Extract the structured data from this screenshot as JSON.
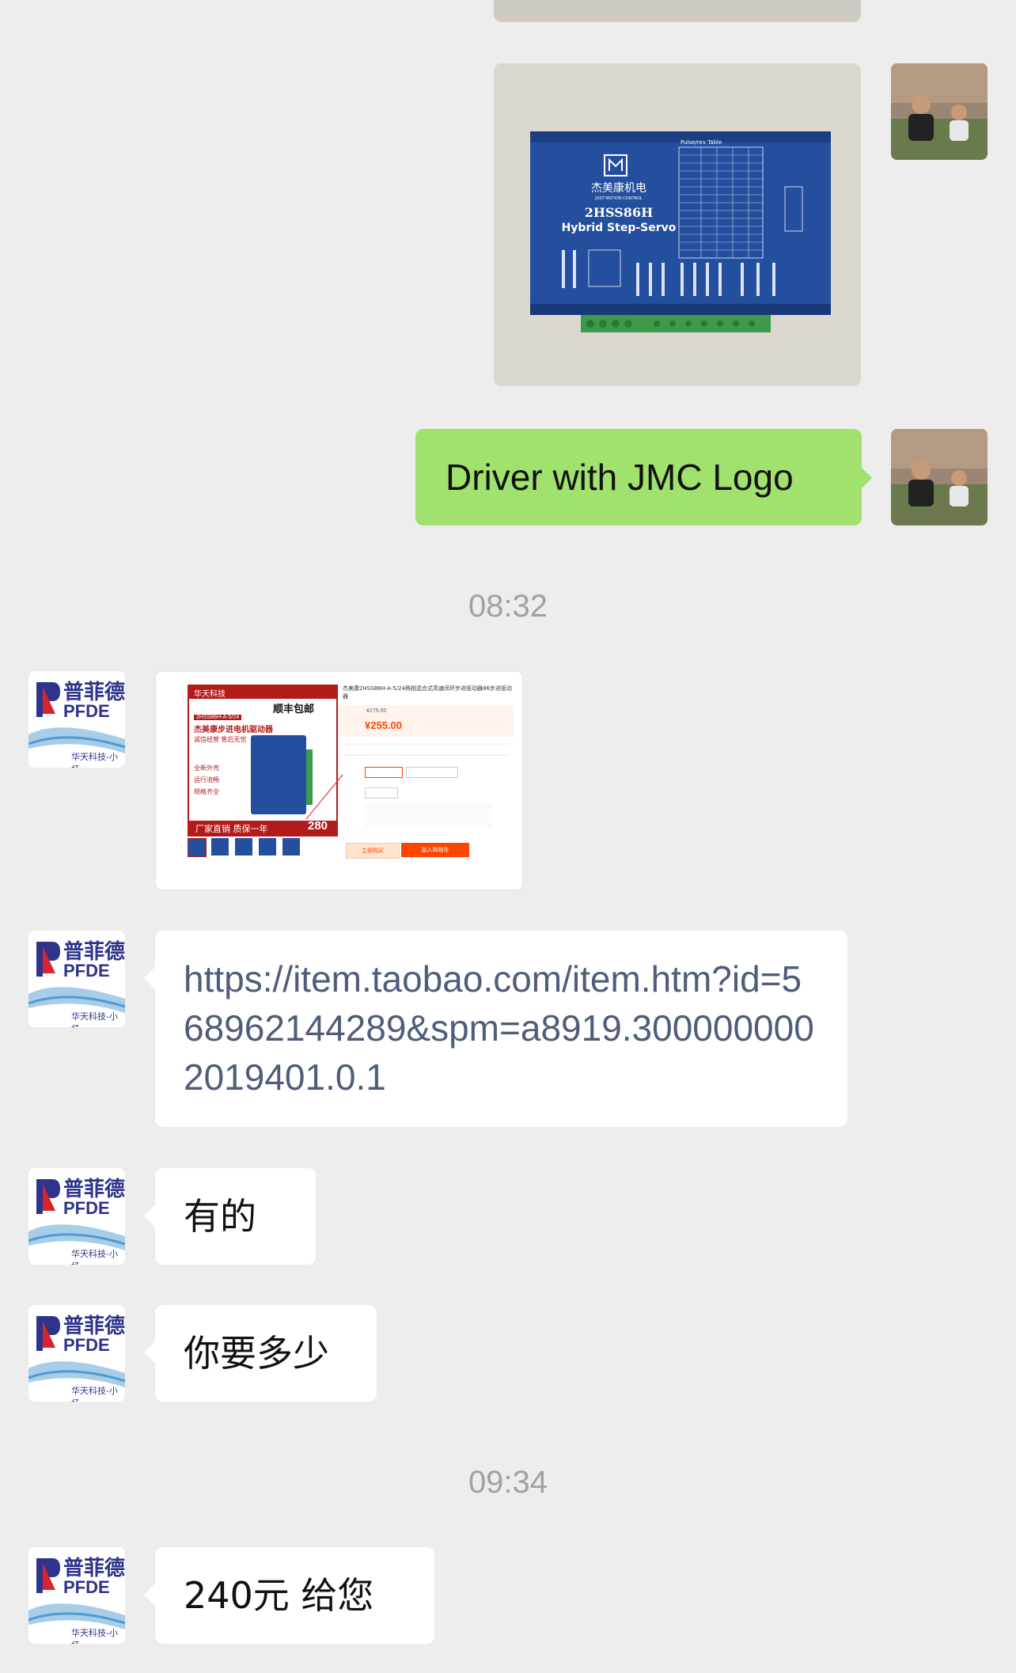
{
  "chat": {
    "msg_jmc": "Driver with JMC Logo",
    "time_1": "08:32",
    "link": "https://item.taobao.com/item.htm?id=568962144289&spm=a8919.3000000002019401.0.1",
    "msg_youde": "有的",
    "msg_how_many": "你要多少",
    "time_2": "09:34",
    "msg_price": "240元 给您"
  },
  "product_photo": {
    "brand_cn": "杰美康机电",
    "brand_en": "JUST MOTION CONTROL",
    "model": "2HSS86H",
    "subtitle": "Hybrid Step-Servo",
    "table_title": "Pulse/rev Table"
  },
  "product_listing": {
    "shop": "华天科技",
    "shipping": "顺丰包邮",
    "model_tag": "2HSS86H-A-5/24",
    "product_name": "杰美康步进电机驱动器",
    "slogan": "诚信经营 售后无忧",
    "bullets": [
      "全新外壳",
      "运行流畅",
      "规格齐全"
    ],
    "footer": "厂家直销 质保一年",
    "price_badge": "280",
    "item_title": "杰美康2HSS86H-A-5/24两相混合式高速闭环步进驱动器86步进驱动器",
    "old_price": "¥275.00",
    "new_price": "¥255.00",
    "buy_now": "立即购买",
    "add_cart": "加入购物车"
  },
  "avatar_labels": {
    "pfde_cn": "普菲德",
    "pfde_en": "PFDE",
    "pfde_sub": "华天科技-小杨"
  }
}
